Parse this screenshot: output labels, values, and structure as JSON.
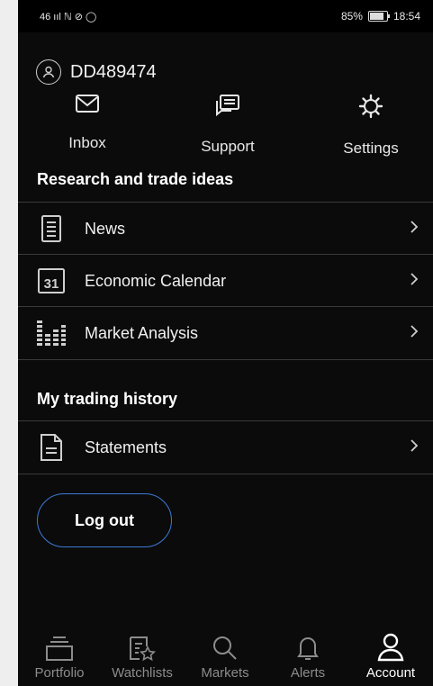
{
  "status": {
    "left": "46 ııl ℕ ⊘ ◯",
    "battery": "85%",
    "time": "18:54",
    "battery_level": 0.85
  },
  "user": {
    "id": "DD489474"
  },
  "quick_actions": [
    {
      "label": "Inbox",
      "icon": "mail-icon"
    },
    {
      "label": "Support",
      "icon": "chat-icon"
    },
    {
      "label": "Settings",
      "icon": "gear-icon"
    }
  ],
  "research": {
    "title": "Research and trade ideas",
    "items": [
      {
        "label": "News",
        "icon": "news-icon"
      },
      {
        "label": "Economic Calendar",
        "icon": "calendar-icon",
        "icon_text": "31"
      },
      {
        "label": "Market Analysis",
        "icon": "chart-icon"
      }
    ]
  },
  "history": {
    "title": "My trading history",
    "items": [
      {
        "label": "Statements",
        "icon": "document-icon"
      }
    ]
  },
  "logout": {
    "label": "Log out"
  },
  "nav": [
    {
      "label": "Portfolio",
      "icon": "portfolio-icon"
    },
    {
      "label": "Watchlists",
      "icon": "watchlist-icon"
    },
    {
      "label": "Markets",
      "icon": "search-icon"
    },
    {
      "label": "Alerts",
      "icon": "bell-icon"
    },
    {
      "label": "Account",
      "icon": "person-icon",
      "active": true
    }
  ],
  "colors": {
    "background": "#0b0b0b",
    "accent": "#3a7bd5",
    "divider": "#3a3a3a",
    "inactive": "#8c8c8c"
  }
}
